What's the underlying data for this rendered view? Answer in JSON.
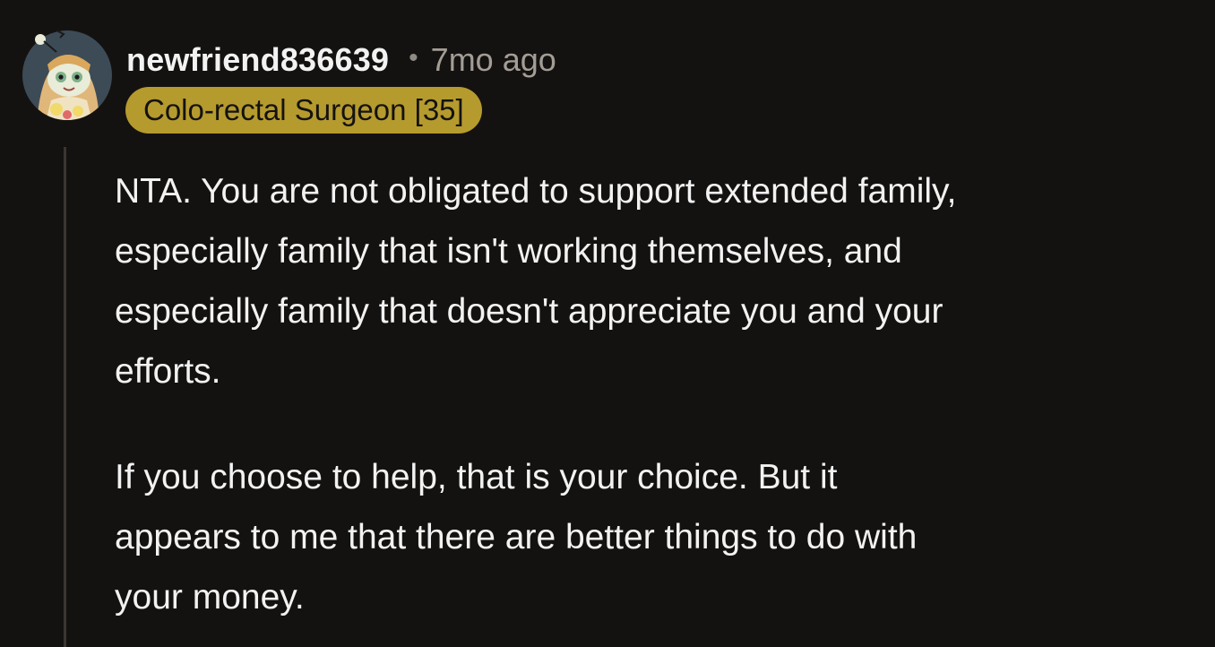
{
  "comment": {
    "username": "newfriend836639",
    "separator": "•",
    "timestamp": "7mo ago",
    "flair": "Colo-rectal Surgeon [35]",
    "avatar_icon": "snoo-avatar-icon",
    "paragraphs": [
      {
        "lines": [
          "NTA. You are not obligated to support extended family,",
          "especially family that isn't working themselves, and",
          "especially family that doesn't appreciate you and your",
          "efforts."
        ]
      },
      {
        "lines": [
          "If you choose to help, that is your choice. But it",
          "appears to me that there are better things to do with",
          "your money."
        ]
      }
    ]
  },
  "colors": {
    "background": "#141210",
    "flair_background": "#b59a2e",
    "text": "#f2f2f2",
    "meta_text": "#a39d96"
  }
}
